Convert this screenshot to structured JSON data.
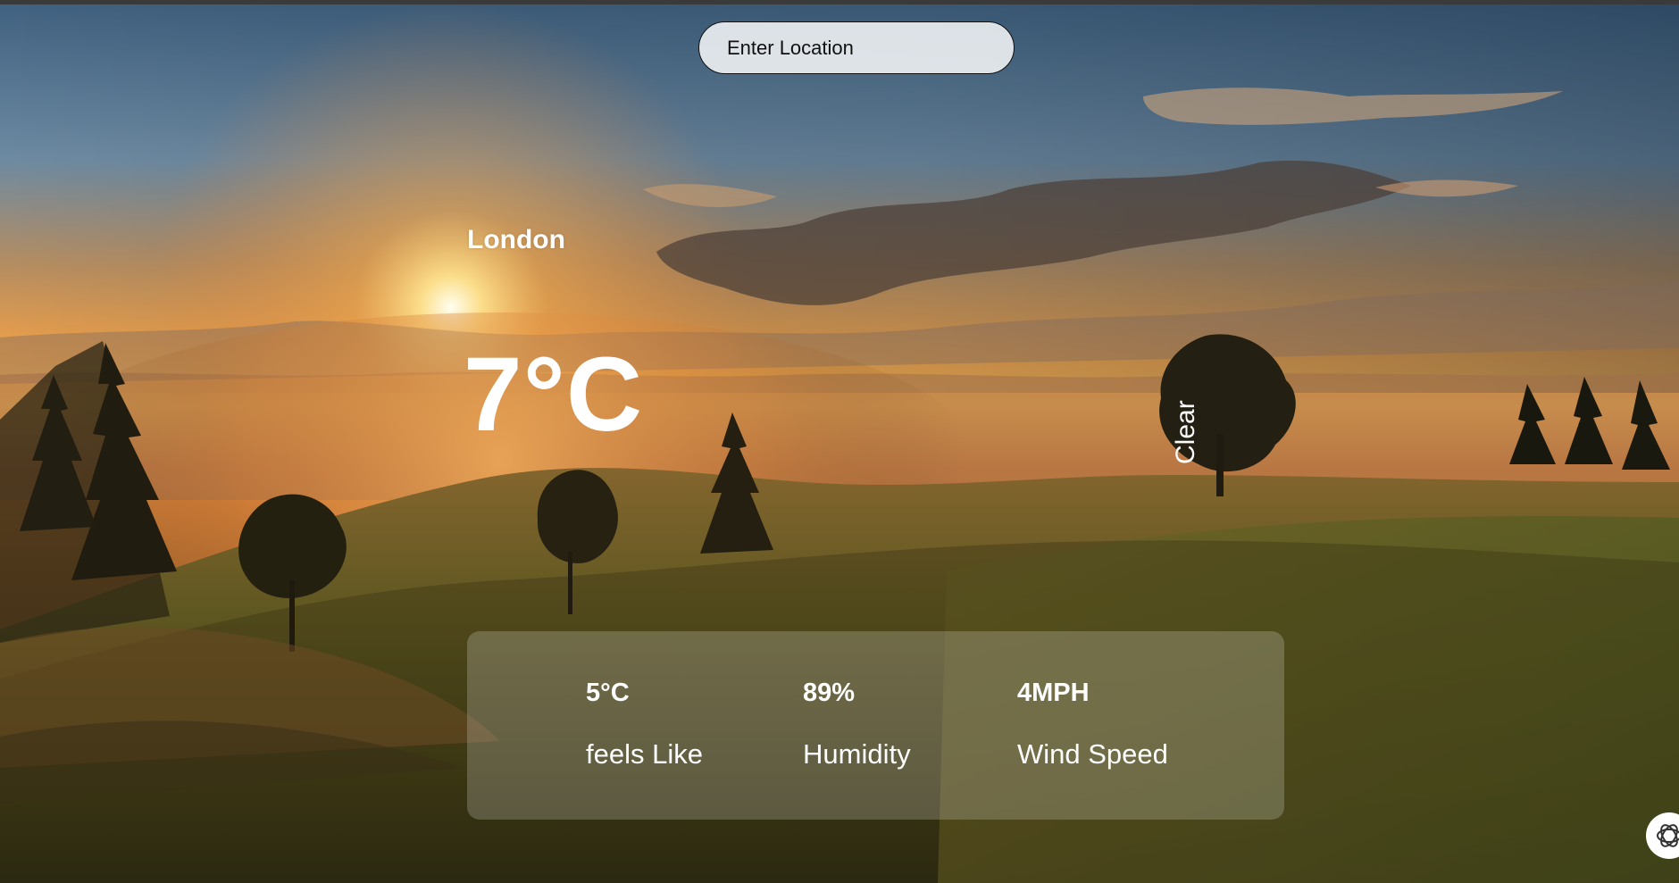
{
  "search": {
    "placeholder": "Enter Location"
  },
  "weather": {
    "city": "London",
    "temperature": "7°C",
    "condition": "Clear"
  },
  "stats": [
    {
      "value": "5°C",
      "label": "feels Like"
    },
    {
      "value": "89%",
      "label": "Humidity"
    },
    {
      "value": "4MPH",
      "label": "Wind Speed"
    }
  ],
  "icons": {
    "corner": "openai-icon"
  },
  "colors": {
    "sky_top": "#4e6f92",
    "sunset": "#f2a548",
    "field": "#55561f",
    "text": "#ffffff"
  }
}
